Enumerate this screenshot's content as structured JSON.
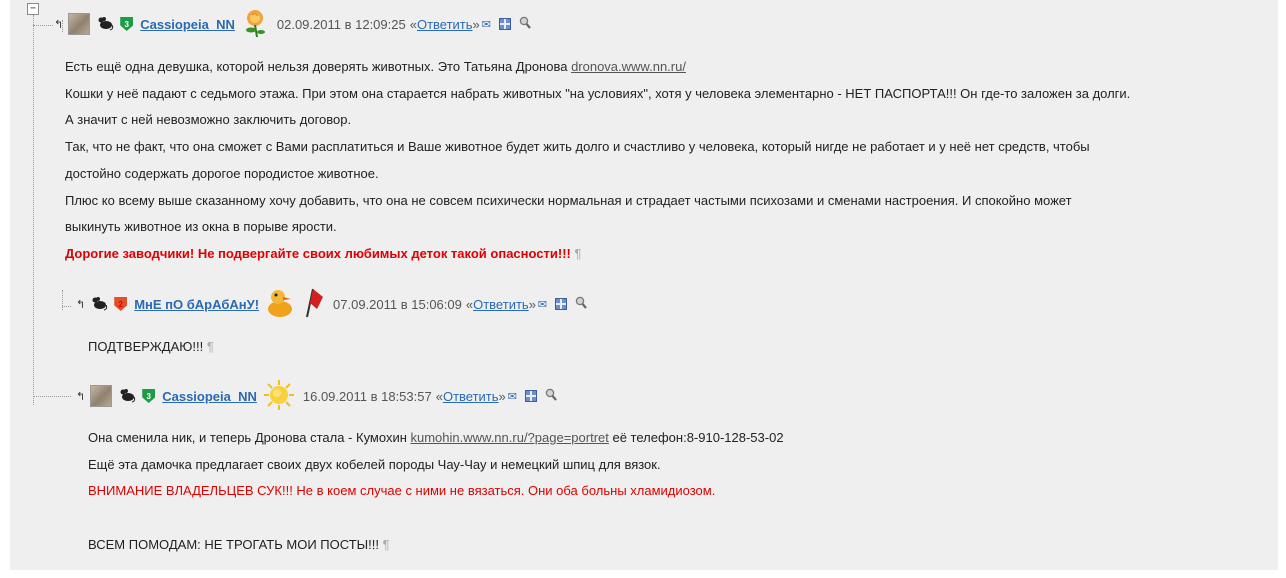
{
  "comments": [
    {
      "author": "Cassiopeia_NN",
      "rank": "3",
      "timestamp": "02.09.2011 в 12:09:25",
      "reply_open": "«",
      "reply_label": "Ответить",
      "reply_close": "»",
      "lines": {
        "l1_text": "Есть ещё одна девушка, которой нельзя доверять животных. Это Татьяна Дронова ",
        "l1_link": "dronova.www.nn.ru/",
        "l2": "Кошки у неё падают с седьмого этажа. При этом она старается набрать животных \"на условиях\", хотя у человека элементарно - НЕТ ПАСПОРТА!!! Он где-то заложен за долги.",
        "l3": "А значит с ней невозможно заключить договор.",
        "l4": "Так, что не факт, что она сможет с Вами расплатиться и Ваше животное будет жить долго и счастливо у человека, который нигде не работает и у неё нет средств, чтобы",
        "l5": "достойно содержать дорогое породистое животное.",
        "l6": "Плюс ко всему выше сказанному хочу добавить, что она не совсем психически нормальная и страдает частыми психозами и сменами настроения. И спокойно может",
        "l7": "выкинуть животное из окна в порыве ярости.",
        "l8": "Дорогие заводчики! Не подвергайте своих любимых деток такой опасности!!!"
      }
    },
    {
      "author": "МнЕ пО бАрАбАнУ!",
      "rank": "2",
      "timestamp": "07.09.2011 в 15:06:09",
      "reply_open": "«",
      "reply_label": "Ответить",
      "reply_close": "»",
      "lines": {
        "l1": "ПОДТВЕРЖДАЮ!!!"
      }
    },
    {
      "author": "Cassiopeia_NN",
      "rank": "3",
      "timestamp": "16.09.2011 в 18:53:57",
      "reply_open": "«",
      "reply_label": "Ответить",
      "reply_close": "»",
      "lines": {
        "l1_text": "Она сменила ник, и теперь Дронова стала - Кумохин ",
        "l1_link": "kumohin.www.nn.ru/?page=portret",
        "l1_tail": " её телефон:8-910-128-53-02",
        "l2": "Ещё эта дамочка предлагает своих двух кобелей породы Чау-Чау и немецкий шпиц для вязок.",
        "l3": "ВНИМАНИЕ ВЛАДЕЛЬЦЕВ СУК!!! Не в коем случае с ними не вязаться. Они оба больны хламидиозом.",
        "l5": "ВСЕМ ПОМОДАМ: НЕ ТРОГАТЬ МОИ ПОСТЫ!!!"
      }
    }
  ],
  "ui": {
    "collapse_symbol": "−",
    "up_arrow": "↰",
    "pilcrow": "¶",
    "mail_symbol": "✉"
  },
  "icons": {
    "collapse": "minus-box-icon",
    "up": "up-arrow-icon",
    "mouse": "mouse-icon",
    "rank": "rank-badge-icon",
    "rose": "rose-icon",
    "duck": "duck-icon",
    "flag": "flag-icon",
    "sun": "sun-icon",
    "mail": "mail-icon",
    "gift": "gift-icon",
    "search": "search-icon"
  },
  "colors": {
    "panel_bg": "#efefef",
    "link_blue": "#2a69b4",
    "alert_red": "#e00000",
    "rank_green": "#1e9b46",
    "rank_red": "#e0502a"
  }
}
